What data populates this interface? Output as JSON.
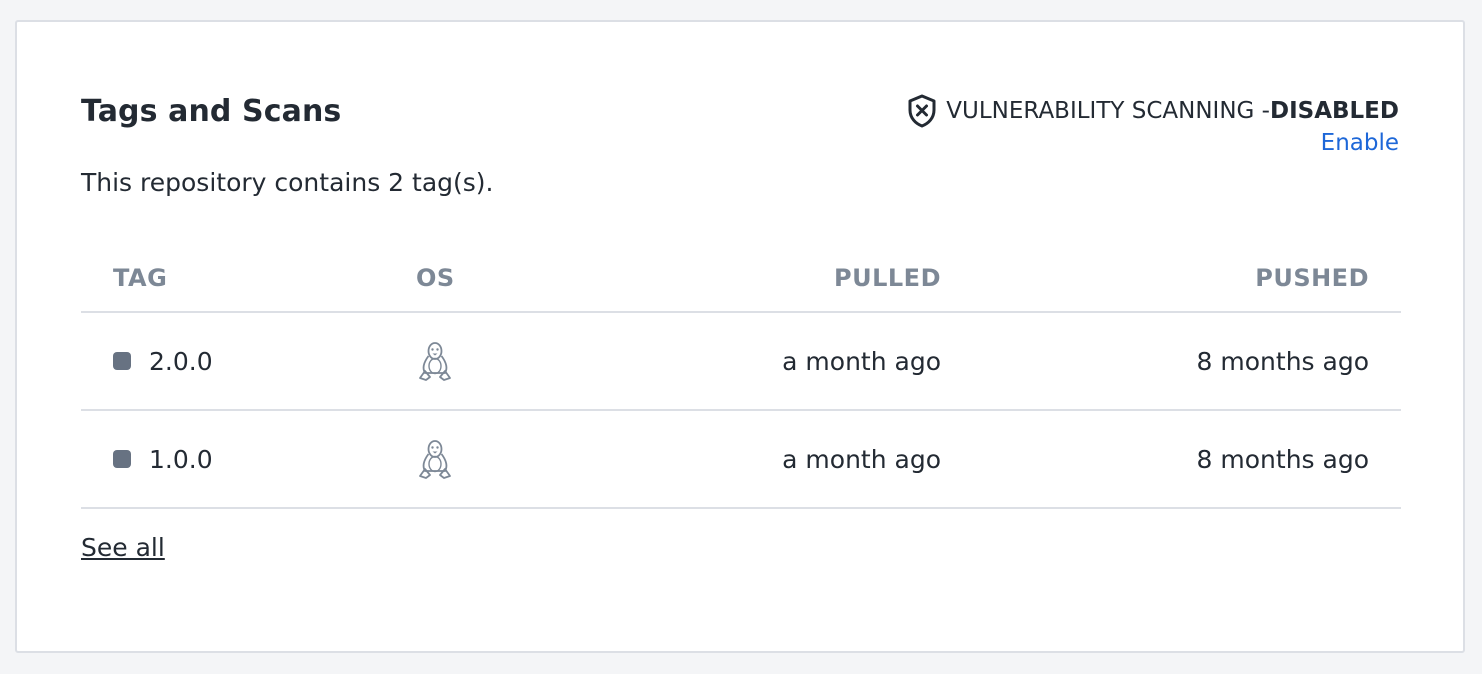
{
  "panel": {
    "title": "Tags and Scans",
    "summary": "This repository contains 2 tag(s).",
    "see_all_label": "See all"
  },
  "scanning": {
    "icon": "shield-x-icon",
    "label": "VULNERABILITY SCANNING - ",
    "state": "DISABLED",
    "enable_label": "Enable"
  },
  "table": {
    "columns": [
      "TAG",
      "OS",
      "PULLED",
      "PUSHED"
    ],
    "rows": [
      {
        "tag": "2.0.0",
        "os_icon": "linux-icon",
        "pulled": "a month ago",
        "pushed": "8 months ago"
      },
      {
        "tag": "1.0.0",
        "os_icon": "linux-icon",
        "pulled": "a month ago",
        "pushed": "8 months ago"
      }
    ]
  },
  "colors": {
    "link": "#1d67d8",
    "header_text": "#7d8896",
    "border": "#dcdfe5",
    "tag_dot": "#677282"
  }
}
